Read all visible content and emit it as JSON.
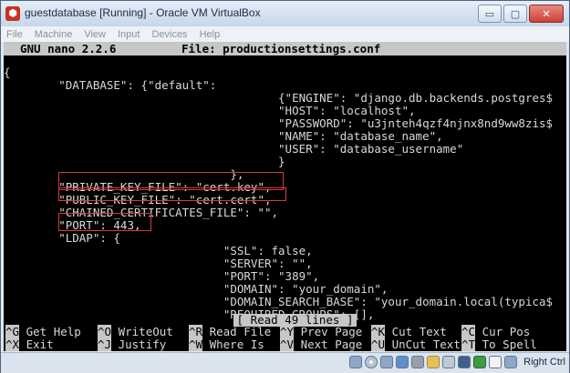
{
  "window": {
    "title": "guestdatabase [Running] - Oracle VM VirtualBox",
    "controls": {
      "minimize": "▭",
      "restore": "▢",
      "close": "✕"
    }
  },
  "menu": [
    "File",
    "Machine",
    "View",
    "Input",
    "Devices",
    "Help"
  ],
  "nano": {
    "version": "GNU nano 2.2.6",
    "file": "File: productionsettings.conf",
    "lines": [
      "{",
      "        \"DATABASE\": {\"default\":",
      "                                        {\"ENGINE\": \"django.db.backends.postgres$",
      "                                        \"HOST\": \"localhost\",",
      "                                        \"PASSWORD\": \"u3jnteh4qzf4njnx8nd9ww8zis$",
      "                                        \"NAME\": \"database_name\",",
      "                                        \"USER\": \"database_username\"",
      "                                        }",
      "                                 },",
      "        \"PRIVATE_KEY_FILE\": \"cert.key\",",
      "        \"PUBLIC_KEY_FILE\": \"cert.cert\",",
      "        \"CHAINED_CERTIFICATES_FILE\": \"\",",
      "        \"PORT\": 443,",
      "        \"LDAP\": {",
      "                                \"SSL\": false,",
      "                                \"SERVER\": \"\",",
      "                                \"PORT\": \"389\",",
      "                                \"DOMAIN\": \"your_domain\",",
      "                                \"DOMAIN_SEARCH_BASE\": \"your_domain.local(typica$",
      "                                \"REQUIRED_GROUPS\": [],"
    ],
    "status": "[ Read 49 lines ]",
    "shortcuts_row1": [
      {
        "key": "^G",
        "label": "Get Help"
      },
      {
        "key": "^O",
        "label": "WriteOut"
      },
      {
        "key": "^R",
        "label": "Read File"
      },
      {
        "key": "^Y",
        "label": "Prev Page"
      },
      {
        "key": "^K",
        "label": "Cut Text"
      },
      {
        "key": "^C",
        "label": "Cur Pos"
      }
    ],
    "shortcuts_row2": [
      {
        "key": "^X",
        "label": "Exit"
      },
      {
        "key": "^J",
        "label": "Justify"
      },
      {
        "key": "^W",
        "label": "Where Is"
      },
      {
        "key": "^V",
        "label": "Next Page"
      },
      {
        "key": "^U",
        "label": "UnCut Text"
      },
      {
        "key": "^T",
        "label": "To Spell"
      }
    ]
  },
  "statusbar": {
    "host_key": "Right Ctrl"
  },
  "colors": {
    "highlight_box": "#d93a3a",
    "terminal_bg": "#000000",
    "nano_bar": "#c7c7c7"
  }
}
